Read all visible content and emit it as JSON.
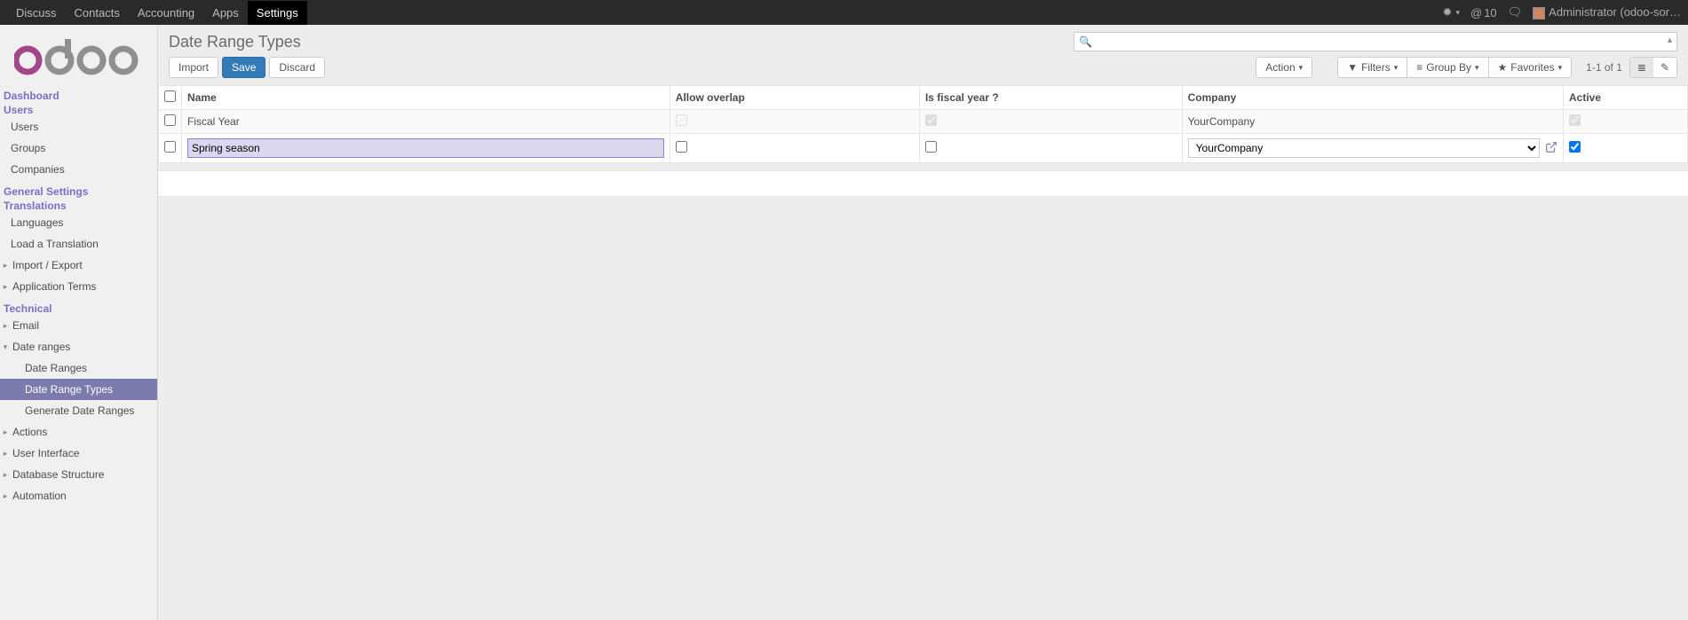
{
  "top_nav": {
    "items": [
      "Discuss",
      "Contacts",
      "Accounting",
      "Apps",
      "Settings"
    ],
    "active_index": 4,
    "mentions_count": "10",
    "user_label": "Administrator (odoo-sor…"
  },
  "sidebar": {
    "sections": [
      {
        "title": "Dashboard",
        "items": []
      },
      {
        "title": "Users",
        "items": [
          {
            "label": "Users",
            "indent": 1
          },
          {
            "label": "Groups",
            "indent": 1
          },
          {
            "label": "Companies",
            "indent": 1
          }
        ]
      },
      {
        "title": "General Settings",
        "items": []
      },
      {
        "title": "Translations",
        "items": [
          {
            "label": "Languages",
            "indent": 1
          },
          {
            "label": "Load a Translation",
            "indent": 1
          },
          {
            "label": "Import / Export",
            "indent": 1,
            "caret": true
          },
          {
            "label": "Application Terms",
            "indent": 1,
            "caret": true
          }
        ]
      },
      {
        "title": "Technical",
        "items": [
          {
            "label": "Email",
            "indent": 1,
            "caret": true
          },
          {
            "label": "Date ranges",
            "indent": 1,
            "caret": true,
            "expanded": true
          },
          {
            "label": "Date Ranges",
            "indent": 2
          },
          {
            "label": "Date Range Types",
            "indent": 2,
            "active": true
          },
          {
            "label": "Generate Date Ranges",
            "indent": 2
          },
          {
            "label": "Actions",
            "indent": 1,
            "caret": true
          },
          {
            "label": "User Interface",
            "indent": 1,
            "caret": true
          },
          {
            "label": "Database Structure",
            "indent": 1,
            "caret": true
          },
          {
            "label": "Automation",
            "indent": 1,
            "caret": true
          }
        ]
      }
    ]
  },
  "header": {
    "breadcrumb": "Date Range Types",
    "search_placeholder": ""
  },
  "toolbar": {
    "import_label": "Import",
    "save_label": "Save",
    "discard_label": "Discard",
    "action_label": "Action",
    "filters_label": "Filters",
    "groupby_label": "Group By",
    "favorites_label": "Favorites",
    "pager": "1-1 of 1"
  },
  "table": {
    "columns": [
      "Name",
      "Allow overlap",
      "Is fiscal year ?",
      "Company",
      "Active"
    ],
    "rows": [
      {
        "name": "Fiscal Year",
        "allow_overlap": false,
        "is_fiscal_year": true,
        "company": "YourCompany",
        "active": true,
        "editing": false
      },
      {
        "name": "Spring season",
        "allow_overlap": false,
        "is_fiscal_year": false,
        "company": "YourCompany",
        "active": true,
        "editing": true
      }
    ]
  }
}
